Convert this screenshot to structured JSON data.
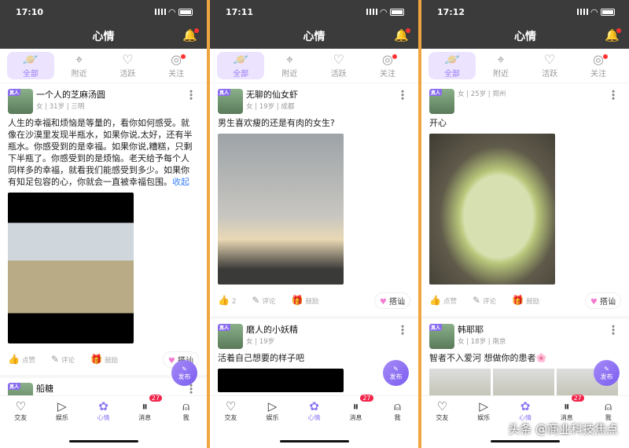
{
  "header": {
    "title": "心情"
  },
  "tabs": [
    {
      "label": "全部",
      "icon": "planet-icon"
    },
    {
      "label": "附近",
      "icon": "location-icon"
    },
    {
      "label": "活跃",
      "icon": "heartbeat-icon"
    },
    {
      "label": "关注",
      "icon": "target-icon"
    }
  ],
  "nav": [
    {
      "label": "交友",
      "icon": "heart-icon"
    },
    {
      "label": "娱乐",
      "icon": "video-icon"
    },
    {
      "label": "心情",
      "icon": "mood-icon"
    },
    {
      "label": "消息",
      "icon": "message-icon",
      "badge": "27"
    },
    {
      "label": "我",
      "icon": "user-icon"
    }
  ],
  "actions": {
    "like": "点赞",
    "comment": "评论",
    "encourage": "鼓励",
    "chat": "搭讪"
  },
  "fab": "发布",
  "avatar_badge": "真人",
  "accent": "#8b78f3",
  "watermark": "头条 @商业科技焦点",
  "phones": [
    {
      "time": "17:10",
      "posts": [
        {
          "name": "一个人的芝麻汤圆",
          "meta": "女 | 31岁 | 三明",
          "text": "人生的幸福和烦恼是等量的，看你如何感受。就像在沙漠里发现半瓶水，如果你说,太好，还有半瓶水。你感受到的是幸福。如果你说,糟糕，只剩下半瓶了。你感受到的是烦恼。老天给予每个人同样多的幸福，就看我们能感受到多少。如果你有知足包容的心，你就会一直被幸福包围。",
          "collapse": "收起",
          "image": "girl-photo"
        },
        {
          "name": "船糖",
          "meta": "",
          "text": ""
        }
      ]
    },
    {
      "time": "17:11",
      "posts": [
        {
          "name": "无聊的仙女虾",
          "meta": "女 | 19岁 | 成都",
          "text": "男生喜欢瘦的还是有肉的女生?",
          "image": "sky-photo",
          "likes": "2"
        },
        {
          "name": "磨人的小妖精",
          "meta": "女 | 19岁",
          "text": "活着自己想要的样子吧",
          "image": "black-photo"
        }
      ]
    },
    {
      "time": "17:12",
      "posts": [
        {
          "name": "",
          "meta": "女 | 25岁 | 郑州",
          "text": "开心",
          "image": "durian-photo"
        },
        {
          "name": "韩耶耶",
          "meta": "女 | 18岁 | 南京",
          "text": "智者不入爱河 想做你的患者🌸",
          "image": "three-photos"
        }
      ]
    }
  ]
}
